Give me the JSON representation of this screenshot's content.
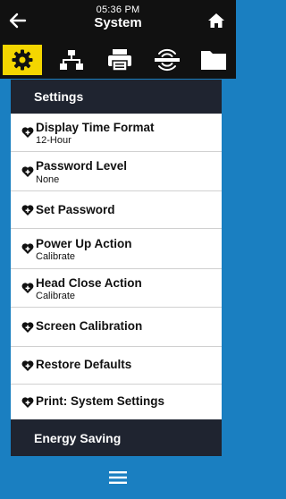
{
  "header": {
    "time": "05:36 PM",
    "title": "System"
  },
  "tabs": [
    {
      "icon": "gear-icon",
      "active": true
    },
    {
      "icon": "network-icon",
      "active": false
    },
    {
      "icon": "printer-icon",
      "active": false
    },
    {
      "icon": "wireless-sensor-icon",
      "active": false
    },
    {
      "icon": "folder-icon",
      "active": false
    }
  ],
  "sections": {
    "settings_label": "Settings",
    "energy_label": "Energy Saving"
  },
  "items": [
    {
      "label": "Display Time Format",
      "value": "12-Hour"
    },
    {
      "label": "Password Level",
      "value": "None"
    },
    {
      "label": "Set Password"
    },
    {
      "label": "Power Up Action",
      "value": "Calibrate"
    },
    {
      "label": "Head Close Action",
      "value": "Calibrate"
    },
    {
      "label": "Screen Calibration"
    },
    {
      "label": "Restore Defaults"
    },
    {
      "label": "Print: System Settings"
    }
  ],
  "colors": {
    "accent": "#f4d600",
    "background": "#1a7fc1",
    "bar": "#111111",
    "section": "#1f2430"
  }
}
